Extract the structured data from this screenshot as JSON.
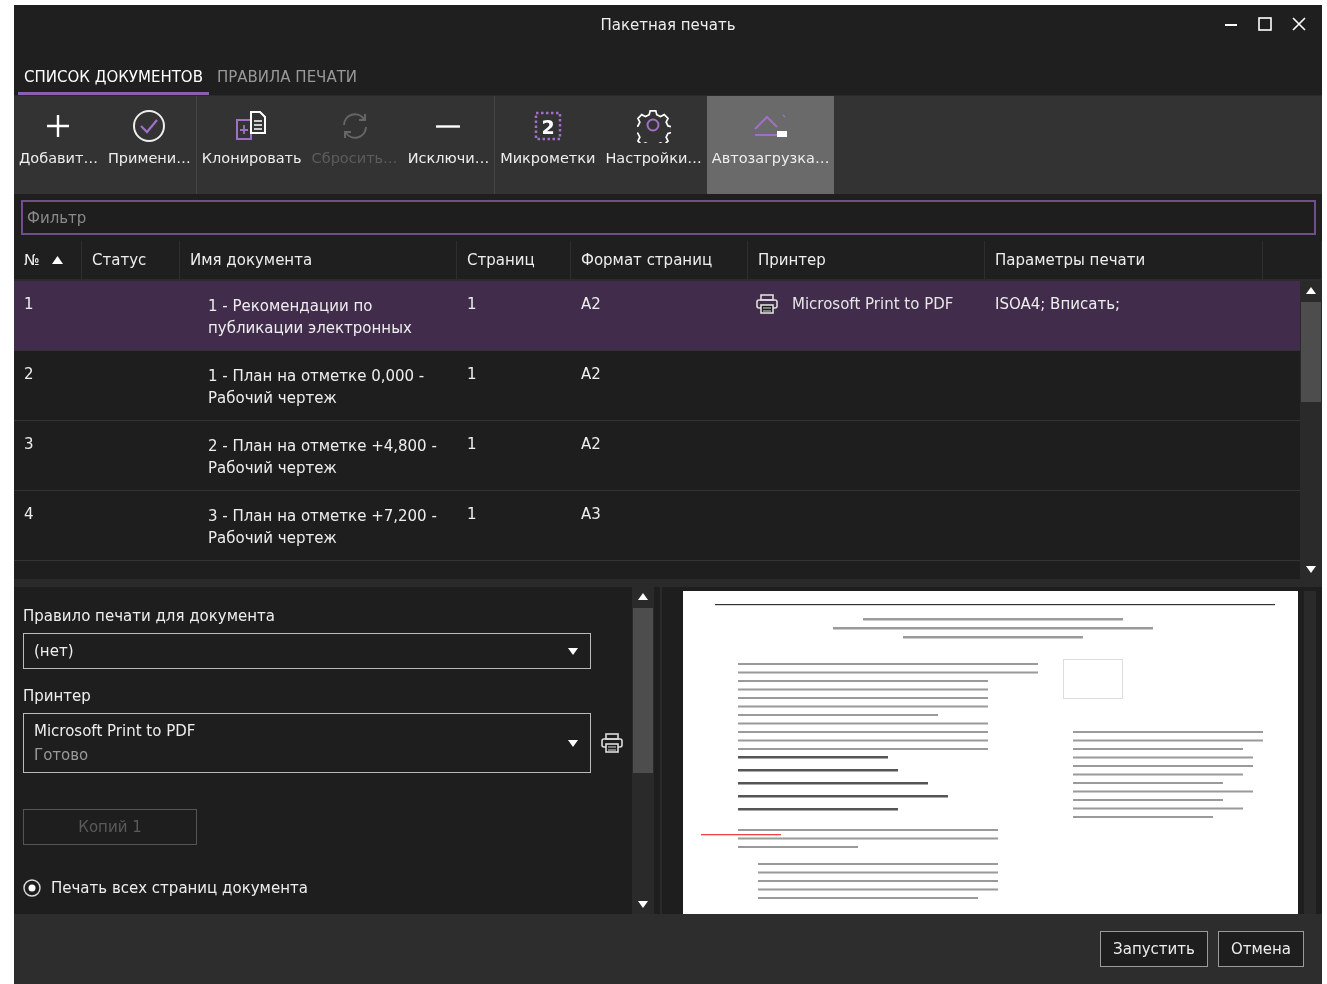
{
  "window": {
    "title": "Пакетная печать"
  },
  "tabs": [
    {
      "label": "СПИСОК ДОКУМЕНТОВ",
      "selected": true
    },
    {
      "label": "ПРАВИЛА ПЕЧАТИ",
      "selected": false
    }
  ],
  "toolbar": [
    {
      "kind": "plus",
      "label": "Добавит…",
      "disabled": false,
      "selected": false,
      "group_start": false
    },
    {
      "kind": "check",
      "label": "Примени…",
      "disabled": false,
      "selected": false,
      "group_start": false
    },
    {
      "kind": "clone",
      "label": "Клонировать",
      "disabled": false,
      "selected": false,
      "group_start": true
    },
    {
      "kind": "reset",
      "label": "Сбросить…",
      "disabled": true,
      "selected": false,
      "group_start": false
    },
    {
      "kind": "minus",
      "label": "Исключи…",
      "disabled": false,
      "selected": false,
      "group_start": false
    },
    {
      "kind": "stamp",
      "icon_text": "2",
      "label": "Микрометки",
      "disabled": false,
      "selected": false,
      "group_start": true
    },
    {
      "kind": "gear",
      "label": "Настройки…",
      "disabled": false,
      "selected": false,
      "group_start": false
    },
    {
      "kind": "autoload",
      "label": "Автозагрузка…",
      "disabled": false,
      "selected": true,
      "group_start": false
    }
  ],
  "filter": {
    "placeholder": "Фильтр"
  },
  "table": {
    "columns": [
      {
        "label": "№",
        "sorted": true
      },
      {
        "label": "Статус",
        "sorted": false
      },
      {
        "label": "Имя документа",
        "sorted": false
      },
      {
        "label": "Страниц",
        "sorted": false
      },
      {
        "label": "Формат страниц",
        "sorted": false
      },
      {
        "label": "Принтер",
        "sorted": false
      },
      {
        "label": "Параметры печати",
        "sorted": false
      }
    ],
    "rows": [
      {
        "number": "1",
        "name": "1 - Рекомендации по публикации электронных",
        "pages": "1",
        "format": "A2",
        "printer": "Microsoft Print to PDF",
        "params": "ISOA4; Вписать;",
        "selected": true
      },
      {
        "number": "2",
        "name": "1 - План на отметке 0,000 - Рабочий чертеж",
        "pages": "1",
        "format": "A2",
        "selected": false
      },
      {
        "number": "3",
        "name": "2 - План на отметке +4,800 - Рабочий чертеж",
        "pages": "1",
        "format": "A2",
        "selected": false
      },
      {
        "number": "4",
        "name": "3 - План на отметке +7,200  - Рабочий чертеж",
        "pages": "1",
        "format": "A3",
        "selected": false
      }
    ]
  },
  "settings": {
    "rule": {
      "label": "Правило печати для документа",
      "value": "(нет)"
    },
    "printer": {
      "label": "Принтер",
      "value": "Microsoft Print to PDF",
      "status": "Готово"
    },
    "copies": {
      "label": "Копий 1",
      "disabled": true
    },
    "page_range": {
      "label": "Печать всех страниц документа",
      "selected": true
    }
  },
  "buttons": [
    "Запустить",
    "Отмена"
  ]
}
